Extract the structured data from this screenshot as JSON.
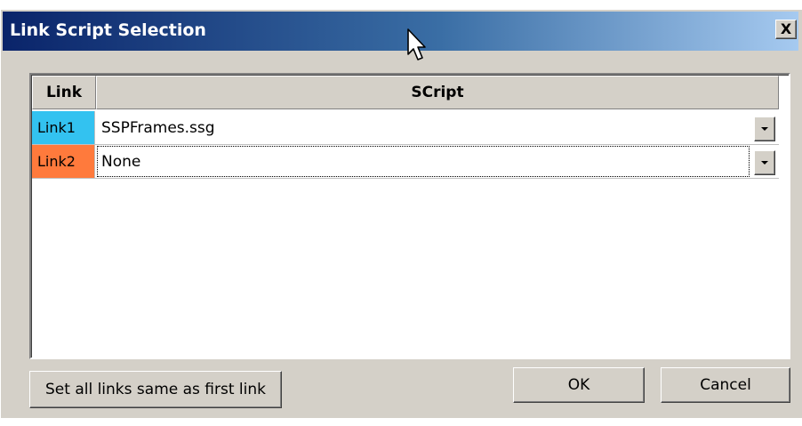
{
  "window": {
    "title": "Link Script Selection",
    "close_label": "X"
  },
  "grid": {
    "columns": [
      "Link",
      "SCript"
    ],
    "rows": [
      {
        "link": "Link1",
        "script": "SSPFrames.ssg",
        "link_color": "#33c2f0"
      },
      {
        "link": "Link2",
        "script": "None",
        "link_color": "#ff7a3c"
      }
    ]
  },
  "buttons": {
    "set_all_label": "Set all links same as first link",
    "ok_label": "OK",
    "cancel_label": "Cancel"
  }
}
